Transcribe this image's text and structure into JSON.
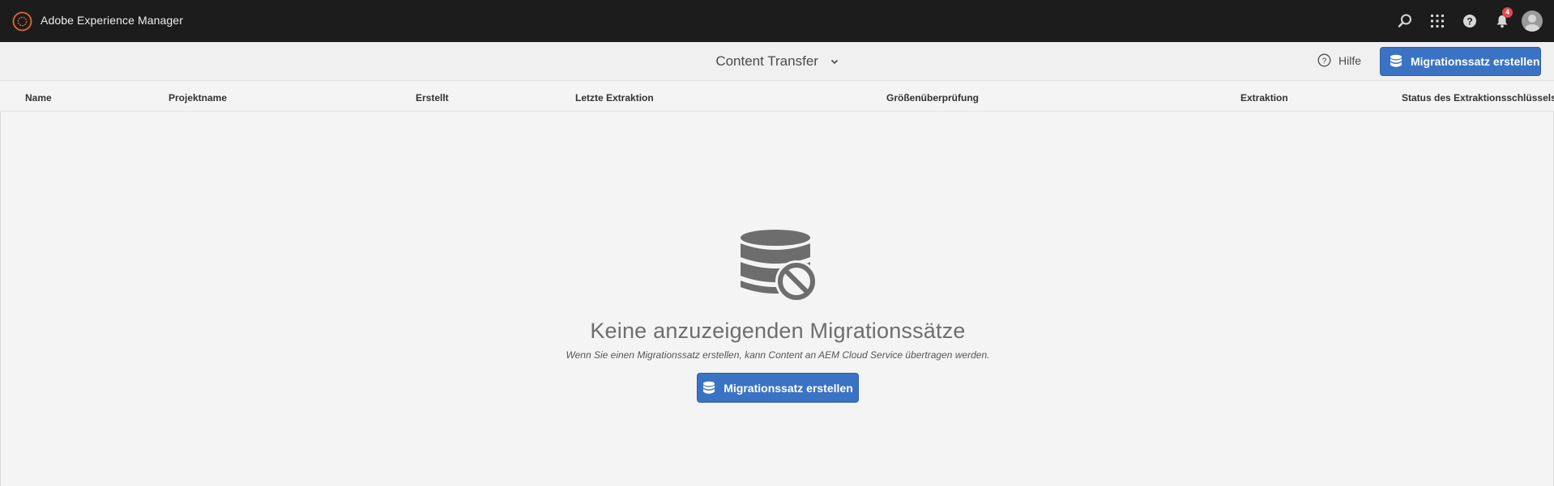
{
  "shell": {
    "title": "Adobe Experience Manager",
    "notifications_count": "4",
    "icons": [
      "search-icon",
      "apps-grid-icon",
      "help-icon",
      "bell-icon",
      "avatar"
    ]
  },
  "actionbar": {
    "view_title": "Content Transfer",
    "help_label": "Hilfe",
    "create_label": "Migrationssatz erstellen"
  },
  "columns": [
    "Name",
    "Projektname",
    "Erstellt",
    "Letzte Extraktion",
    "Größenüberprüfung",
    "Extraktion",
    "Status des Extraktionsschlüssels"
  ],
  "empty_state": {
    "heading": "Keine anzuzeigenden Migrationssätze",
    "description": "Wenn Sie einen Migrationssatz erstellen, kann Content an AEM Cloud Service übertragen werden.",
    "create_label": "Migrationssatz erstellen",
    "icon": "database-blocked-icon"
  },
  "colors": {
    "shell_bg": "#1c1c1c",
    "brand_orange": "#e46a2b",
    "primary_blue": "#3b73c4",
    "badge_red": "#e34850"
  }
}
